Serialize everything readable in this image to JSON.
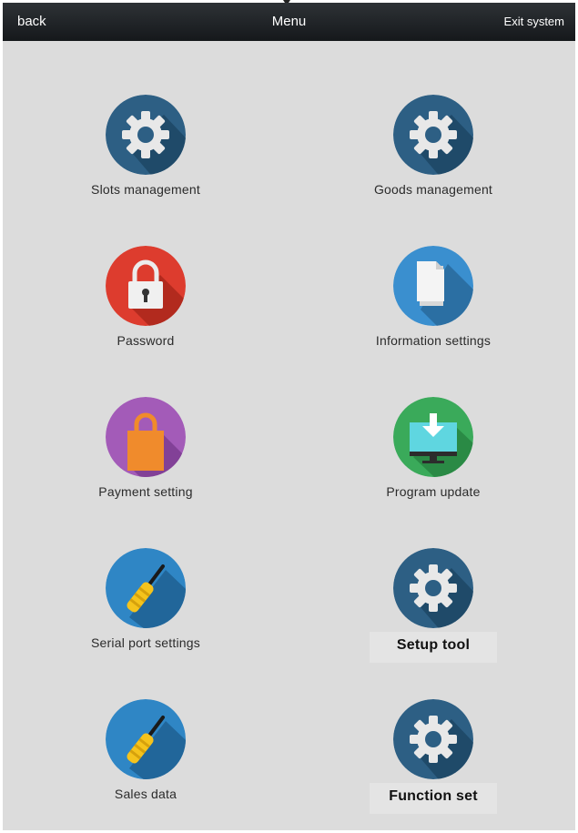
{
  "topbar": {
    "back_label": "back",
    "title": "Menu",
    "exit_label": "Exit system"
  },
  "menu": {
    "items": [
      {
        "label": "Slots management",
        "icon": "gear-icon",
        "color": "#2d5f84"
      },
      {
        "label": "Goods management",
        "icon": "gear-icon",
        "color": "#2d5f84"
      },
      {
        "label": "Password",
        "icon": "lock-icon",
        "color": "#dd3c2e"
      },
      {
        "label": "Information settings",
        "icon": "document-icon",
        "color": "#3a8fcf"
      },
      {
        "label": "Payment setting",
        "icon": "shopping-bag-icon",
        "color": "#a35bb8"
      },
      {
        "label": "Program update",
        "icon": "download-monitor-icon",
        "color": "#3aaa5a"
      },
      {
        "label": "Serial port settings",
        "icon": "screwdriver-icon",
        "color": "#2f86c5"
      },
      {
        "label": "Setup tool",
        "icon": "gear-icon",
        "color": "#2d5f84"
      },
      {
        "label": "Sales data",
        "icon": "screwdriver-icon",
        "color": "#2f86c5"
      },
      {
        "label": "Function set",
        "icon": "gear-icon",
        "color": "#2d5f84"
      }
    ]
  }
}
